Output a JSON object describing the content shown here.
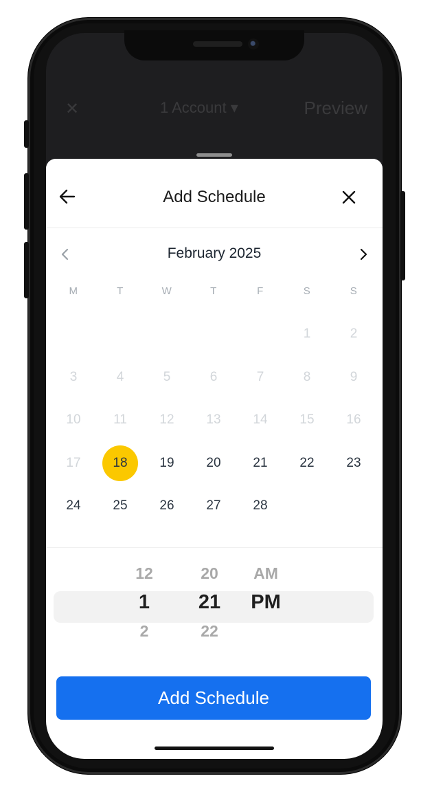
{
  "background_screen": {
    "close_label": "✕",
    "account_label": "1 Account ▾",
    "preview_label": "Preview"
  },
  "sheet": {
    "title": "Add Schedule",
    "back_icon": "arrow-left-icon",
    "close_icon": "close-icon"
  },
  "calendar": {
    "month_label": "February 2025",
    "prev_icon": "chevron-left-icon",
    "next_icon": "chevron-right-icon",
    "weekdays": [
      "M",
      "T",
      "W",
      "T",
      "F",
      "S",
      "S"
    ],
    "days": [
      {
        "label": "",
        "state": "empty"
      },
      {
        "label": "",
        "state": "empty"
      },
      {
        "label": "",
        "state": "empty"
      },
      {
        "label": "",
        "state": "empty"
      },
      {
        "label": "",
        "state": "empty"
      },
      {
        "label": "1",
        "state": "muted"
      },
      {
        "label": "2",
        "state": "muted"
      },
      {
        "label": "3",
        "state": "muted"
      },
      {
        "label": "4",
        "state": "muted"
      },
      {
        "label": "5",
        "state": "muted"
      },
      {
        "label": "6",
        "state": "muted"
      },
      {
        "label": "7",
        "state": "muted"
      },
      {
        "label": "8",
        "state": "muted"
      },
      {
        "label": "9",
        "state": "muted"
      },
      {
        "label": "10",
        "state": "muted"
      },
      {
        "label": "11",
        "state": "muted"
      },
      {
        "label": "12",
        "state": "muted"
      },
      {
        "label": "13",
        "state": "muted"
      },
      {
        "label": "14",
        "state": "muted"
      },
      {
        "label": "15",
        "state": "muted"
      },
      {
        "label": "16",
        "state": "muted"
      },
      {
        "label": "17",
        "state": "muted"
      },
      {
        "label": "18",
        "state": "selected"
      },
      {
        "label": "19",
        "state": "normal"
      },
      {
        "label": "20",
        "state": "normal"
      },
      {
        "label": "21",
        "state": "normal"
      },
      {
        "label": "22",
        "state": "normal"
      },
      {
        "label": "23",
        "state": "normal"
      },
      {
        "label": "24",
        "state": "normal"
      },
      {
        "label": "25",
        "state": "normal"
      },
      {
        "label": "26",
        "state": "normal"
      },
      {
        "label": "27",
        "state": "normal"
      },
      {
        "label": "28",
        "state": "normal"
      }
    ],
    "selected_color": "#fbc800"
  },
  "time_picker": {
    "hour": {
      "prev": "12",
      "selected": "1",
      "next": "2"
    },
    "minute": {
      "prev": "20",
      "selected": "21",
      "next": "22"
    },
    "ampm": {
      "prev": "AM",
      "selected": "PM"
    }
  },
  "actions": {
    "add_label": "Add Schedule",
    "accent_color": "#1570ef"
  }
}
